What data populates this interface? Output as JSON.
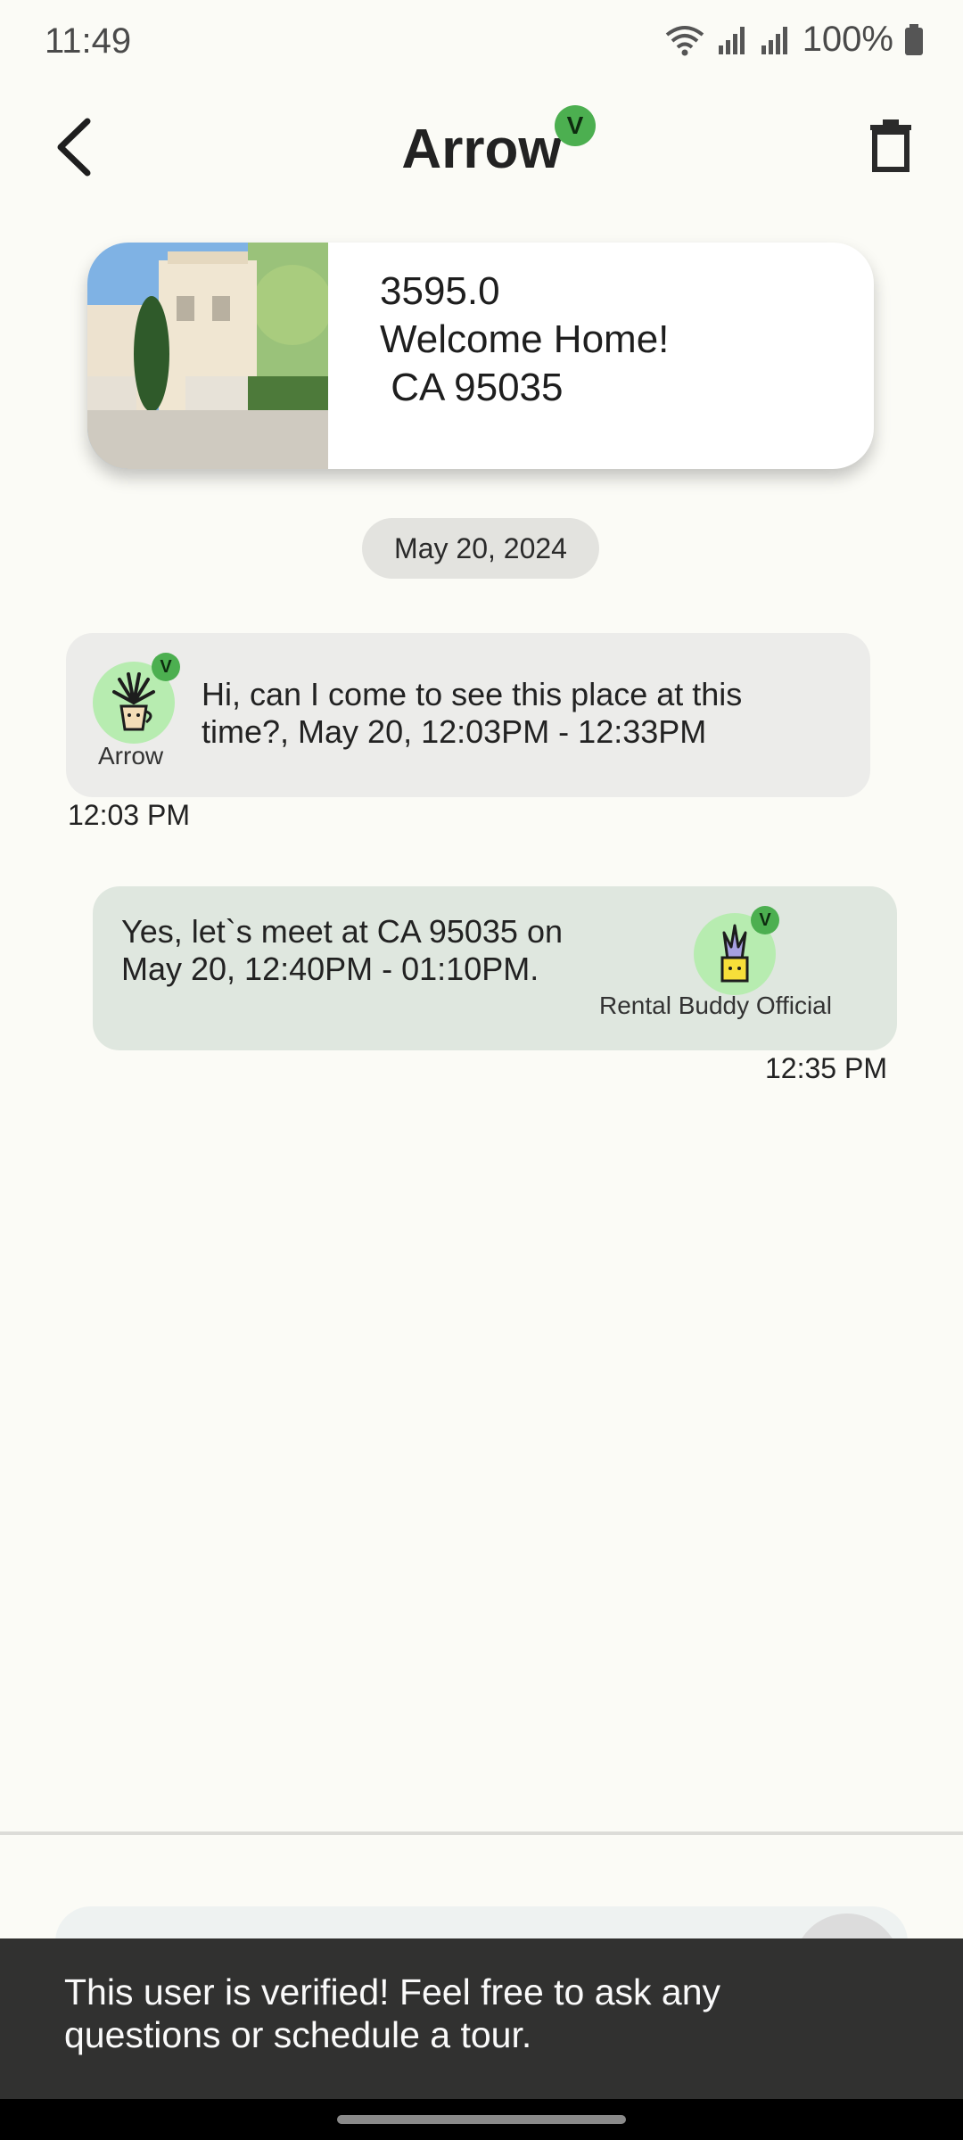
{
  "status_bar": {
    "time": "11:49",
    "battery": "100%",
    "icons": [
      "wifi-icon",
      "signal-icon",
      "signal-r-icon",
      "battery-icon"
    ]
  },
  "header": {
    "title": "Arrow",
    "verified_badge": "V",
    "back_icon": "chevron-left-icon",
    "delete_icon": "trash-icon"
  },
  "listing": {
    "price": "3595.0",
    "headline": "Welcome Home!",
    "location": " CA 95035"
  },
  "date_chip": "May 20, 2024",
  "messages": [
    {
      "direction": "incoming",
      "sender": "Arrow",
      "badge": "V",
      "text": "Hi, can I come to see this place at this time?, May 20, 12:03PM - 12:33PM",
      "time": "12:03 PM"
    },
    {
      "direction": "outgoing",
      "sender": "Rental Buddy Official",
      "badge": "V",
      "text": "Yes, let`s meet at  CA 95035 on May 20, 12:40PM - 01:10PM.",
      "time": "12:35 PM"
    }
  ],
  "snackbar": {
    "text": "This user is verified! Feel free to ask any questions or schedule a tour."
  },
  "colors": {
    "background": "#fbfbf6",
    "verified": "#4caf50",
    "incoming_bubble": "#ececea",
    "outgoing_bubble": "#dfe7df",
    "snackbar": "#313130"
  }
}
